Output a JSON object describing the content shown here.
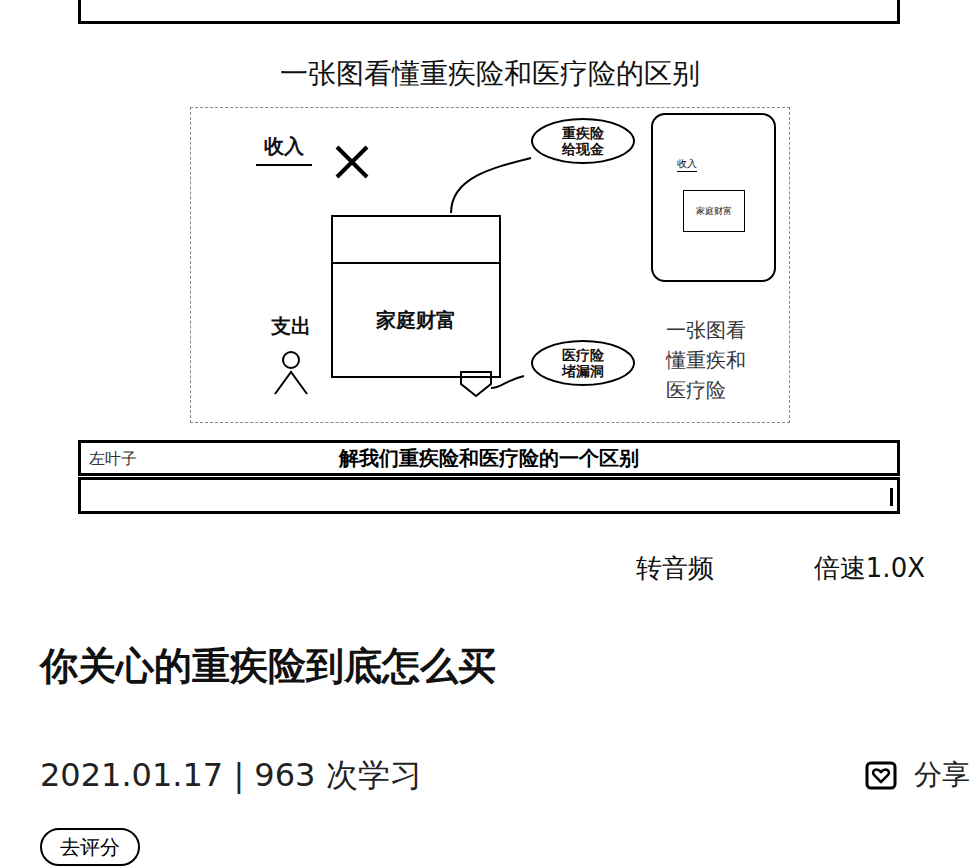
{
  "video": {
    "slide_title": "一张图看懂重疾险和医疗险的区别",
    "diagram": {
      "income": "收入",
      "critical_bubble": [
        "重疾险",
        "给现金"
      ],
      "wealth": "家庭财富",
      "expense": "支出",
      "medical_bubble": [
        "医疗险",
        "堵漏洞"
      ],
      "inset": {
        "income": "收入",
        "wealth": "家庭财富"
      },
      "side_note": "一张图看懂重疾和医疗险"
    },
    "watermark": "左叶子",
    "subtitle": "解我们重疾险和医疗险的一个区别"
  },
  "controls": [
    {
      "label": "转音频"
    },
    {
      "label": "倍速1.0X"
    }
  ],
  "article": {
    "title": "你关心的重疾险到底怎么买",
    "date": "2021.01.17",
    "separator": "|",
    "views": "963 次学习"
  },
  "share": {
    "label": "分享"
  },
  "rate_button": {
    "label": "去评分"
  }
}
